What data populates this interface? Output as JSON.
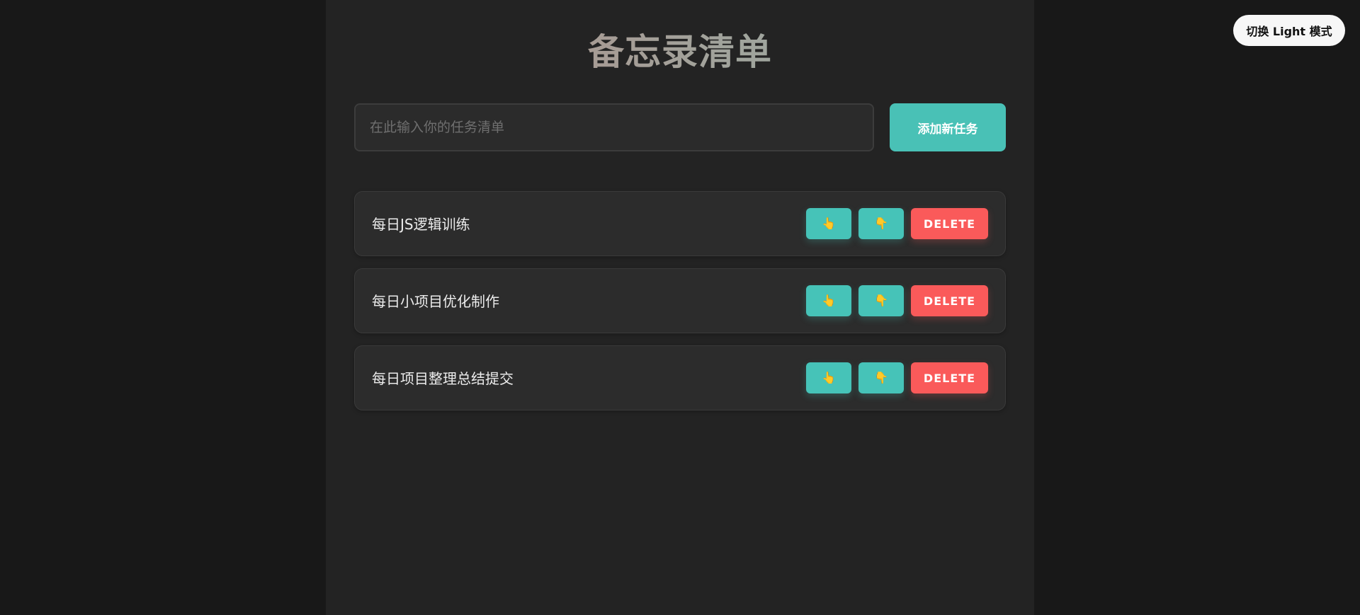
{
  "theme_toggle": {
    "label": "切换 Light 模式"
  },
  "header": {
    "title": "备忘录清单"
  },
  "new_task": {
    "placeholder": "在此输入你的任务清单",
    "value": "",
    "add_label": "添加新任务"
  },
  "icons": {
    "move_up": "👆",
    "move_down": "👇",
    "move_up_name": "pointing-up-hand-icon",
    "move_down_name": "pointing-down-hand-icon"
  },
  "tasks": [
    {
      "text": "每日JS逻辑训练",
      "delete_label": "DELETE"
    },
    {
      "text": "每日小项目优化制作",
      "delete_label": "DELETE"
    },
    {
      "text": "每日项目整理总结提交",
      "delete_label": "DELETE"
    }
  ],
  "colors": {
    "background": "#181818",
    "container": "#232323",
    "accent": "#49c1b6",
    "danger": "#fa5a5a"
  }
}
